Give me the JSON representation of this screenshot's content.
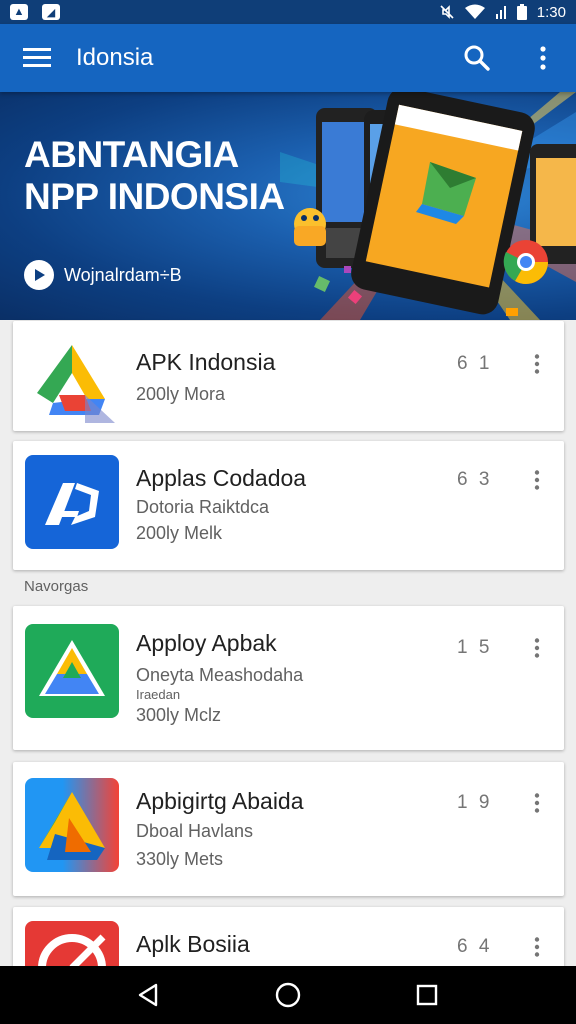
{
  "status_bar": {
    "time": "1:30",
    "icons": [
      "notification-a-icon",
      "notification-b-icon",
      "mute-icon",
      "wifi-icon",
      "signal-icon",
      "battery-icon"
    ]
  },
  "app_bar": {
    "title": "Idonsia",
    "menu_icon": "hamburger-menu-icon",
    "search_icon": "search-icon",
    "more_icon": "more-vert-icon",
    "color": "#1565c0"
  },
  "banner": {
    "title_line1": "ABNTANGIA",
    "title_line2": "NPP INDONSIA",
    "link_label": "Wojnalrdam÷B"
  },
  "apps": [
    {
      "name": "APK Indonsia",
      "subtitle": "",
      "meta": "200ly Mora",
      "rating": "6 1"
    },
    {
      "name": "Applas Codadoa",
      "subtitle": "Dotoria Raiktdca",
      "meta": "200ly Melk",
      "rating": "6 3"
    },
    {
      "name": "Apploy Apbak",
      "subtitle": "Oneyta Meashodaha",
      "extra": "Iraedan",
      "meta": "300ly Mclz",
      "rating": "1 5"
    },
    {
      "name": "Apbigirtg Abaida",
      "subtitle": "Dboal Havlans",
      "meta": "330ly Mets",
      "rating": "1 9"
    },
    {
      "name": "Aplk Bosiia",
      "subtitle": "",
      "meta": "",
      "rating": "6 4"
    }
  ],
  "section_label": "Navorgas",
  "nav_bar": {
    "back_icon": "back-triangle-icon",
    "home_icon": "home-circle-icon",
    "recents_icon": "recents-square-icon"
  }
}
